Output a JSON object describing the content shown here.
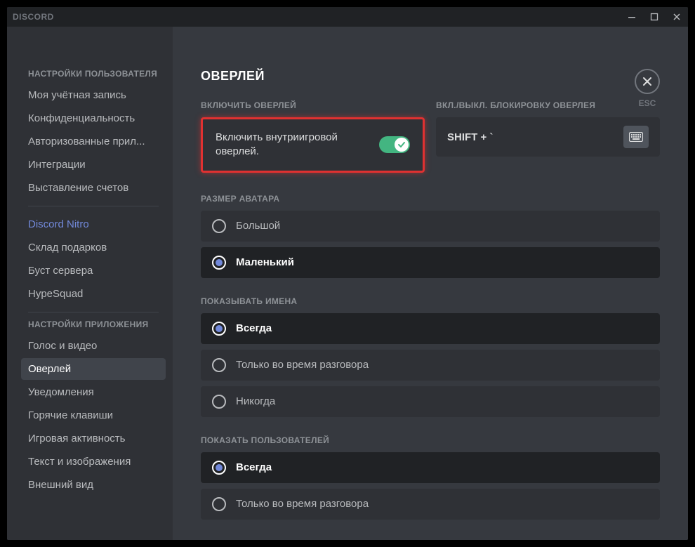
{
  "app": {
    "name": "DISCORD"
  },
  "esc": {
    "label": "ESC"
  },
  "sidebar": {
    "groups": [
      {
        "header": "НАСТРОЙКИ ПОЛЬЗОВАТЕЛЯ",
        "items": [
          {
            "label": "Моя учётная запись"
          },
          {
            "label": "Конфиденциальность"
          },
          {
            "label": "Авторизованные прил..."
          },
          {
            "label": "Интеграции"
          },
          {
            "label": "Выставление счетов"
          }
        ]
      },
      {
        "header": "",
        "items": [
          {
            "label": "Discord Nitro",
            "nitro": true
          },
          {
            "label": "Склад подарков"
          },
          {
            "label": "Буст сервера"
          },
          {
            "label": "HypeSquad"
          }
        ]
      },
      {
        "header": "НАСТРОЙКИ ПРИЛОЖЕНИЯ",
        "items": [
          {
            "label": "Голос и видео"
          },
          {
            "label": "Оверлей",
            "selected": true
          },
          {
            "label": "Уведомления"
          },
          {
            "label": "Горячие клавиши"
          },
          {
            "label": "Игровая активность"
          },
          {
            "label": "Текст и изображения"
          },
          {
            "label": "Внешний вид"
          }
        ]
      }
    ]
  },
  "page": {
    "title": "ОВЕРЛЕЙ",
    "enable": {
      "header": "ВКЛЮЧИТЬ ОВЕРЛЕЙ",
      "label": "Включить внутриигровой оверлей.",
      "value": true
    },
    "lock": {
      "header": "ВКЛ./ВЫКЛ. БЛОКИРОВКУ ОВЕРЛЕЯ",
      "value": "SHIFT + `"
    },
    "avatar": {
      "header": "РАЗМЕР АВАТАРА",
      "options": [
        {
          "label": "Большой",
          "selected": false
        },
        {
          "label": "Маленький",
          "selected": true
        }
      ]
    },
    "names": {
      "header": "ПОКАЗЫВАТЬ ИМЕНА",
      "options": [
        {
          "label": "Всегда",
          "selected": true
        },
        {
          "label": "Только во время разговора",
          "selected": false
        },
        {
          "label": "Никогда",
          "selected": false
        }
      ]
    },
    "users": {
      "header": "ПОКАЗАТЬ ПОЛЬЗОВАТЕЛЕЙ",
      "options": [
        {
          "label": "Всегда",
          "selected": true
        },
        {
          "label": "Только во время разговора",
          "selected": false
        }
      ]
    }
  }
}
